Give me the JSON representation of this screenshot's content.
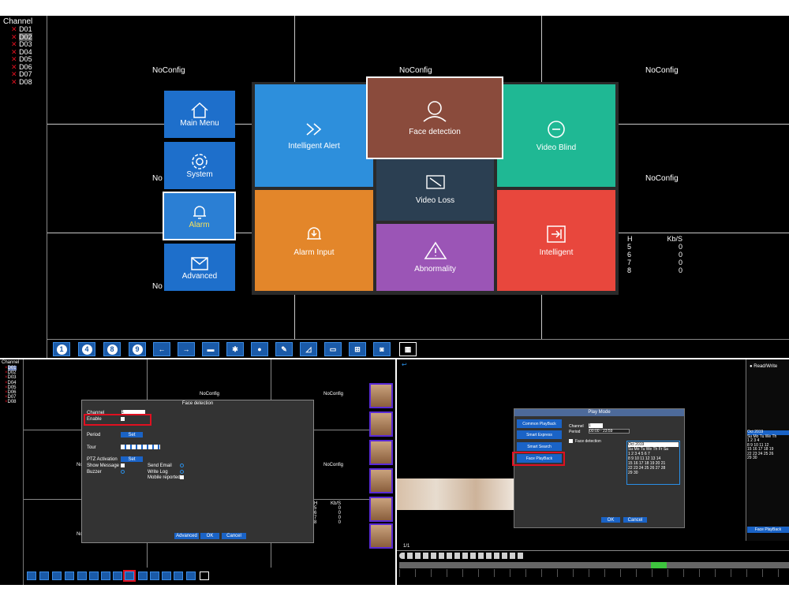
{
  "top": {
    "channel_title": "Channel",
    "channels": [
      "D01",
      "D02",
      "D03",
      "D04",
      "D05",
      "D06",
      "D07",
      "D08"
    ],
    "noconfig": [
      "NoConfig",
      "NoConfig",
      "NoConfig",
      "NoConfig",
      "No",
      "No"
    ],
    "side_menu": [
      "Main Menu",
      "System",
      "Alarm",
      "Advanced"
    ],
    "tiles": {
      "intelligent_alert": "Intelligent Alert",
      "face_detection": "Face detection",
      "video_blind": "Video Blind",
      "video_loss": "Video Loss",
      "alarm_input": "Alarm Input",
      "abnormality": "Abnormality",
      "intelligent": "Intelligent"
    },
    "kbs_header": [
      "H",
      "Kb/S"
    ],
    "kbs_rows": [
      [
        "5",
        "0"
      ],
      [
        "6",
        "0"
      ],
      [
        "7",
        "0"
      ],
      [
        "8",
        "0"
      ]
    ],
    "toolbar": [
      "1",
      "4",
      "8",
      "9"
    ]
  },
  "bottom_left": {
    "channel_title": "Channel",
    "channels": [
      "D01",
      "D02",
      "D03",
      "D04",
      "D05",
      "D06",
      "D07",
      "D08"
    ],
    "noconfig": [
      "NoConfig",
      "NoConfig",
      "No",
      "NoConfig",
      "No"
    ],
    "dialog_title": "Face detection",
    "channel_label": "Channel",
    "channel_value": "1",
    "enable_label": "Enable",
    "period_label": "Period",
    "set_label": "Set",
    "tour_label": "Tour",
    "ptz_label": "PTZ Activation",
    "show_message": "Show Message",
    "buzzer": "Buzzer",
    "send_email": "Send Email",
    "write_log": "Write Log",
    "mobile_reported": "Mobile reported",
    "advanced": "Advanced",
    "ok": "OK",
    "cancel": "Cancel",
    "kbs_header": [
      "H",
      "Kb/S"
    ],
    "kbs_rows": [
      [
        "5",
        "0"
      ],
      [
        "6",
        "0"
      ],
      [
        "7",
        "0"
      ],
      [
        "8",
        "0"
      ]
    ]
  },
  "bottom_right": {
    "read_write": "Read/Write",
    "play_mode_title": "Play Mode",
    "modes": [
      "Common PlayBack",
      "Smart Express",
      "Smart Search",
      "Face PlayBack"
    ],
    "channel_label": "Channel",
    "channel_value": "1",
    "period_label": "Period",
    "period_value": "00:00 - 23:59",
    "face_detection": "Face detection",
    "cal_month": "Oct",
    "cal_year": "2019",
    "cal_header": "Su Mo Tu We Th Fr Sa",
    "cal_rows": [
      "1  2  3  4  5  6  7",
      "8  9 10 11 12 13 14",
      "15 16 17 18 19 20 21",
      "22 23 24 25 26 27 28",
      "29 30"
    ],
    "cal2_rows": [
      "Su Mo Tu We Th",
      "1  2  3  4",
      "8  9 10 11 12",
      "15 16 17 18 19",
      "22 23 24 25 26",
      "29 30"
    ],
    "ok": "OK",
    "cancel": "Cancel",
    "face_playback_label": "Face PlayBack",
    "page": "1/1"
  }
}
